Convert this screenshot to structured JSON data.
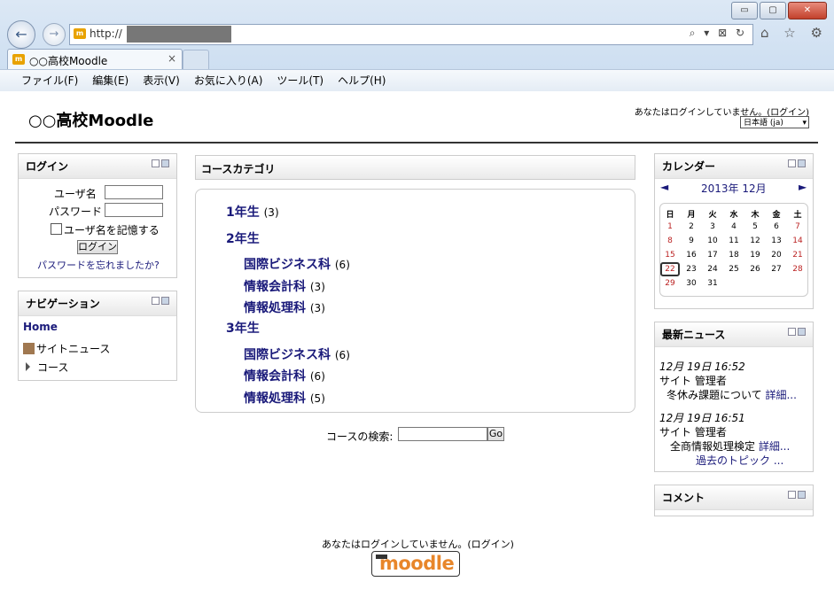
{
  "browser": {
    "url": "http://",
    "tab_title": "○○高校Moodle",
    "tab_close": "×",
    "window_buttons": [
      "▭",
      "▢",
      "✕"
    ],
    "menu": [
      "ファイル(F)",
      "編集(E)",
      "表示(V)",
      "お気に入り(A)",
      "ツール(T)",
      "ヘルプ(H)"
    ],
    "address_icons": "⌕ ▾ ⊠ ↻",
    "toolbar_icons": "⌂ ☆ ⚙"
  },
  "header": {
    "site_title": "○○高校Moodle",
    "login_info": "あなたはログインしていません。(ログイン)",
    "language": "日本語 (ja)"
  },
  "login_block": {
    "title": "ログイン",
    "username_label": "ユーザ名",
    "password_label": "パスワード",
    "remember_label": "ユーザ名を記憶する",
    "login_button": "ログイン",
    "forgot_link": "パスワードを忘れましたか?"
  },
  "navigation_block": {
    "title": "ナビゲーション",
    "home": "Home",
    "site_news": "サイトニュース",
    "courses": "コース"
  },
  "course_categories": {
    "title": "コースカテゴリ",
    "categories": [
      {
        "name": "1年生",
        "count": "(3)",
        "children": []
      },
      {
        "name": "2年生",
        "count": "",
        "children": [
          {
            "name": "国際ビジネス科",
            "count": "(6)"
          },
          {
            "name": "情報会計科",
            "count": "(3)"
          },
          {
            "name": "情報処理科",
            "count": "(3)"
          }
        ]
      },
      {
        "name": "3年生",
        "count": "",
        "children": [
          {
            "name": "国際ビジネス科",
            "count": "(6)"
          },
          {
            "name": "情報会計科",
            "count": "(6)"
          },
          {
            "name": "情報処理科",
            "count": "(5)"
          }
        ]
      }
    ],
    "search_label": "コースの検索:",
    "go_button": "Go"
  },
  "calendar_block": {
    "title": "カレンダー",
    "prev": "◄",
    "next": "►",
    "month": "2013年 12月",
    "weekdays": [
      "日",
      "月",
      "火",
      "水",
      "木",
      "金",
      "土"
    ],
    "weeks": [
      [
        "1",
        "2",
        "3",
        "4",
        "5",
        "6",
        "7"
      ],
      [
        "8",
        "9",
        "10",
        "11",
        "12",
        "13",
        "14"
      ],
      [
        "15",
        "16",
        "17",
        "18",
        "19",
        "20",
        "21"
      ],
      [
        "22",
        "23",
        "24",
        "25",
        "26",
        "27",
        "28"
      ],
      [
        "29",
        "30",
        "31",
        "",
        "",
        "",
        ""
      ]
    ],
    "today": "22"
  },
  "news_block": {
    "title": "最新ニュース",
    "items": [
      {
        "time": "12月 19日 16:52",
        "author": "サイト 管理者",
        "subject": "冬休み課題について",
        "more": "詳細..."
      },
      {
        "time": "12月 19日 16:51",
        "author": "サイト 管理者",
        "subject": "全商情報処理検定",
        "more": "詳細..."
      }
    ],
    "older": "過去のトピック ..."
  },
  "comments_block": {
    "title": "コメント"
  },
  "footer": {
    "login_info": "あなたはログインしていません。(ログイン)",
    "logo_text": "moodle"
  }
}
